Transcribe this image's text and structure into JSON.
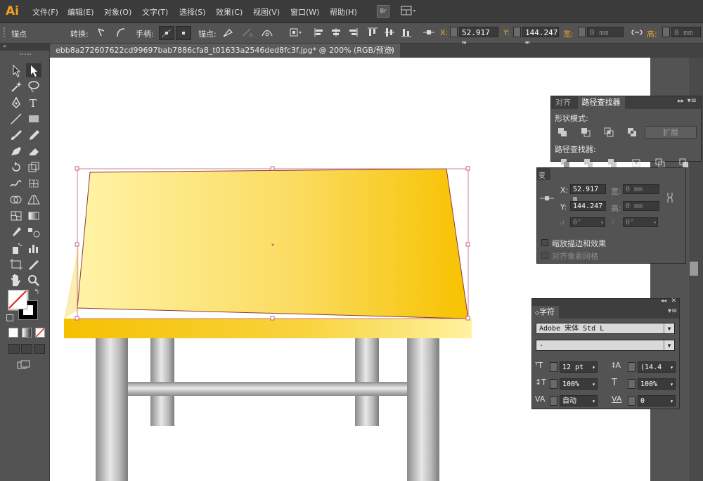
{
  "app": {
    "logo": "Ai"
  },
  "menu": {
    "items": [
      "文件(F)",
      "编辑(E)",
      "对象(O)",
      "文字(T)",
      "选择(S)",
      "效果(C)",
      "视图(V)",
      "窗口(W)",
      "帮助(H)"
    ],
    "bridge_label": "Br"
  },
  "control_bar": {
    "anchor_label": "锚点",
    "convert_label": "转换:",
    "handles_label": "手柄:",
    "anchors_label": "锚点:",
    "x_label": "X:",
    "x_value": "52.917 m",
    "y_label": "Y:",
    "y_value": "144.247 m",
    "w_label": "宽:",
    "w_value": "0 mm",
    "h_label": "高:",
    "h_value": "0 mm"
  },
  "document_tab": {
    "title": "ebb8a272607622cd99697bab7886cfa8_t01633a2546ded8fc3f.jpg* @ 200% (RGB/预览)",
    "close": "✕"
  },
  "pathfinder_panel": {
    "tabs": [
      "对齐",
      "路径查找器"
    ],
    "shape_modes_label": "形状模式:",
    "expand_label": "扩展",
    "pathfinders_label": "路径查找器:"
  },
  "transform_panel": {
    "title": "变换",
    "x_label": "X:",
    "x_value": "52.917 m",
    "w_label": "宽:",
    "w_value": "0 mm",
    "y_label": "Y:",
    "y_value": "144.247",
    "h_label": "高:",
    "h_value": "0 mm",
    "angle_value": "0°",
    "shear_value": "0°",
    "scale_strokes_label": "缩放描边和效果",
    "align_pixel_label": "对齐像素网格"
  },
  "character_panel": {
    "title": "字符",
    "font_family": "Adobe 宋体 Std L",
    "font_style": "-",
    "font_size": "12 pt",
    "leading": "(14.4",
    "vertical_scale": "100%",
    "horizontal_scale": "100%",
    "kerning": "自动",
    "tracking": "0"
  },
  "colors": {
    "ui_bg": "#535353",
    "menubar": "#3c3b3b",
    "accent": "#e7a42f",
    "table_top_light": "#fff3a8",
    "table_top_dark": "#f7c200",
    "selection": "#b33a5a"
  }
}
